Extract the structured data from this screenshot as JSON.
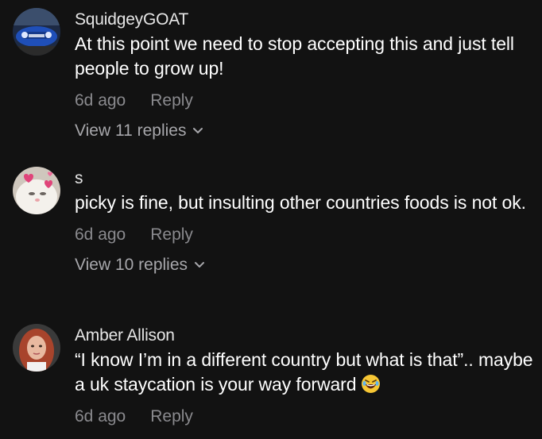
{
  "comments": [
    {
      "username": "SquidgeyGOAT",
      "text": "At this point we need to stop accepting this and just tell people to grow up!",
      "time": "6d ago",
      "reply_label": "Reply",
      "view_replies_label": "View 11 replies",
      "avatar_icon": "blue-car-avatar"
    },
    {
      "username": "s",
      "text": "picky is fine, but insulting other countries foods is not ok.",
      "time": "6d ago",
      "reply_label": "Reply",
      "view_replies_label": "View 10 replies",
      "avatar_icon": "white-cat-hearts-avatar"
    },
    {
      "username": "Amber Allison",
      "text": "“I know I’m in a different country but what is that”.. maybe a uk staycation is your way forward",
      "time": "6d ago",
      "reply_label": "Reply",
      "emoji": "laughing-face-emoji",
      "avatar_icon": "red-hair-woman-avatar"
    }
  ],
  "colors": {
    "background": "#121212",
    "username": "#e6e6e6",
    "text": "#ffffff",
    "meta": "#8a8a8e"
  }
}
